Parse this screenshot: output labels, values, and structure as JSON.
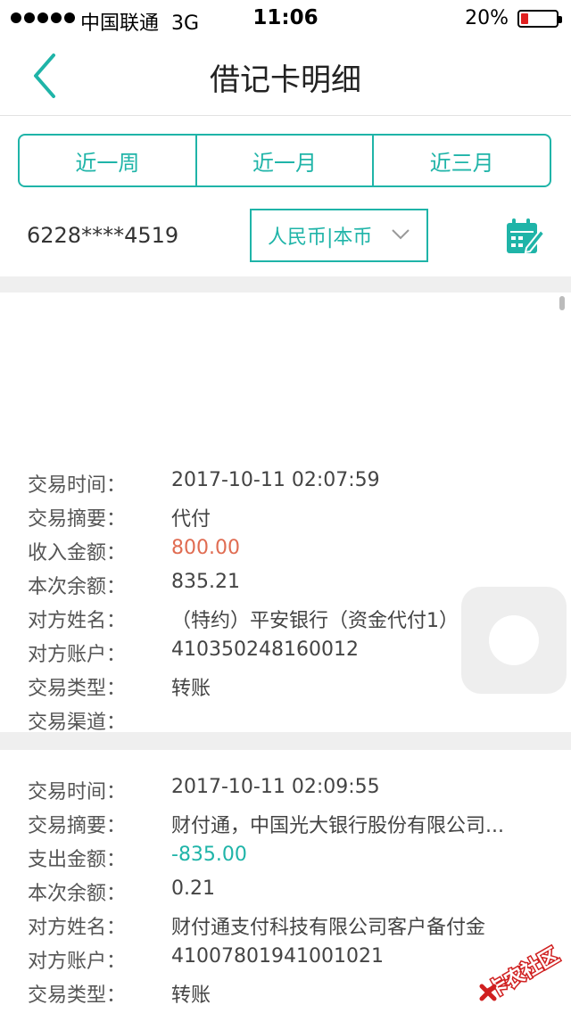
{
  "status_bar": {
    "carrier": "中国联通",
    "network": "3G",
    "time": "11:06",
    "battery_text": "20%",
    "battery_level": 0.2
  },
  "nav": {
    "title": "借记卡明细",
    "back_icon": "chevron-left-icon"
  },
  "period_tabs": [
    "近一周",
    "近一月",
    "近三月"
  ],
  "account": {
    "number": "6228****4519",
    "currency": "人民币|本币",
    "calendar_icon": "calendar-edit-icon"
  },
  "colors": {
    "accent": "#1fb4a8",
    "income": "#e06c52",
    "expense": "#1fb4a8",
    "battery_low": "#e02020"
  },
  "records": [
    {
      "fields": [
        {
          "label": "交易时间：",
          "value": "2017-10-11 02:07:59"
        },
        {
          "label": "交易摘要：",
          "value": "代付"
        },
        {
          "label": "收入金额：",
          "value": "800.00",
          "kind": "income"
        },
        {
          "label": "本次余额：",
          "value": "835.21"
        },
        {
          "label": "对方姓名：",
          "value": "（特约）平安银行（资金代付1）"
        },
        {
          "label": "对方账户：",
          "value": "410350248160012"
        },
        {
          "label": "交易类型：",
          "value": "转账"
        },
        {
          "label": "交易渠道：",
          "value": ""
        }
      ]
    },
    {
      "fields": [
        {
          "label": "交易时间：",
          "value": "2017-10-11 02:09:55"
        },
        {
          "label": "交易摘要：",
          "value": "财付通，中国光大银行股份有限公司..."
        },
        {
          "label": "支出金额：",
          "value": "-835.00",
          "kind": "expense"
        },
        {
          "label": "本次余额：",
          "value": "0.21"
        },
        {
          "label": "对方姓名：",
          "value": "财付通支付科技有限公司客户备付金"
        },
        {
          "label": "对方账户：",
          "value": "41007801941001021"
        },
        {
          "label": "交易类型：",
          "value": "转账"
        }
      ]
    }
  ],
  "watermark": {
    "text": "卡农社区"
  }
}
